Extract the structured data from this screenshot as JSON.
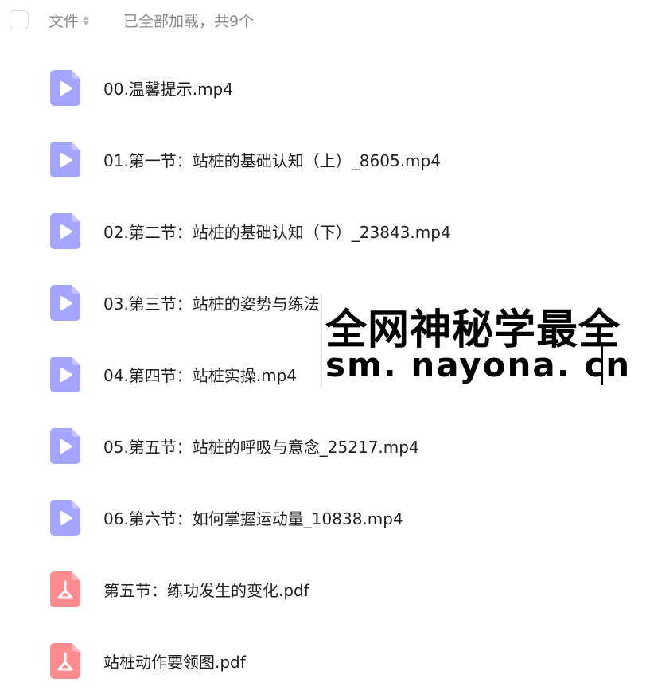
{
  "header": {
    "column_label": "文件",
    "load_status": "已全部加载，共9个"
  },
  "colors": {
    "video_icon": "#a3a5ff",
    "pdf_icon": "#ff8b8f",
    "text_muted": "#8a8a93"
  },
  "files": [
    {
      "name": "00.温馨提示.mp4",
      "icon": "video-file-icon"
    },
    {
      "name": "01.第一节：站桩的基础认知（上）_8605.mp4",
      "icon": "video-file-icon"
    },
    {
      "name": "02.第二节：站桩的基础认知（下）_23843.mp4",
      "icon": "video-file-icon"
    },
    {
      "name": "03.第三节：站桩的姿势与练法",
      "icon": "video-file-icon"
    },
    {
      "name": "04.第四节：站桩实操.mp4",
      "icon": "video-file-icon"
    },
    {
      "name": "05.第五节：站桩的呼吸与意念_25217.mp4",
      "icon": "video-file-icon"
    },
    {
      "name": "06.第六节：如何掌握运动量_10838.mp4",
      "icon": "video-file-icon"
    },
    {
      "name": "第五节：练功发生的变化.pdf",
      "icon": "pdf-file-icon"
    },
    {
      "name": "站桩动作要领图.pdf",
      "icon": "pdf-file-icon"
    }
  ],
  "watermark": {
    "line1": "全网神秘学最全",
    "line2": "sm. nayona. cn"
  }
}
